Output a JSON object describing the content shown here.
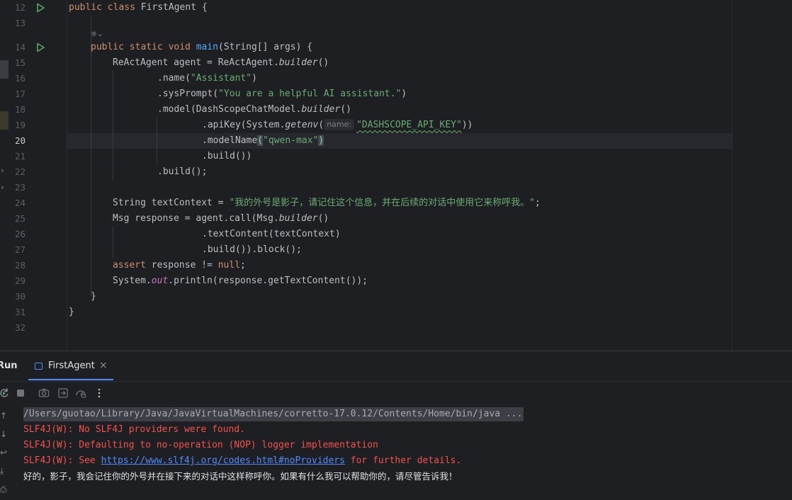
{
  "editor": {
    "line_numbers": [
      "12",
      "13",
      "14",
      "15",
      "16",
      "17",
      "18",
      "19",
      "20",
      "21",
      "22",
      "23",
      "24",
      "25",
      "26",
      "27",
      "28",
      "29",
      "30",
      "31",
      "32"
    ],
    "current_line": "20",
    "ai_hint": "⎈⌄",
    "hint_name": "name:"
  },
  "code": {
    "l12": {
      "kw1": "public class ",
      "name": "FirstAgent {"
    },
    "l14": {
      "kw": "public static void ",
      "fn": "main",
      "rest": "(String[] args) {"
    },
    "l15": {
      "a": "ReActAgent agent = ReActAgent.",
      "it": "builder",
      "b": "()"
    },
    "l16": {
      "a": ".name(",
      "s": "\"Assistant\"",
      "b": ")"
    },
    "l17": {
      "a": ".sysPrompt(",
      "s": "\"You are a helpful AI assistant.\"",
      "b": ")"
    },
    "l18": {
      "a": ".model(DashScopeChatModel.",
      "it": "builder",
      "b": "()"
    },
    "l19": {
      "a": ".apiKey(System.",
      "it": "getenv",
      "b": "(",
      "s": "\"DASHSCOPE_API_KEY\"",
      "c": "))"
    },
    "l20": {
      "a": ".modelName",
      "p1": "(",
      "s": "\"qwen-max\"",
      "p2": ")"
    },
    "l21": {
      "a": ".build())"
    },
    "l22": {
      "a": ".build();"
    },
    "l24": {
      "a": "String textContext = ",
      "s": "\"我的外号是影子，请记住这个信息，并在后续的对话中使用它来称呼我。\"",
      "b": ";"
    },
    "l25": {
      "a": "Msg response = agent.call(Msg.",
      "it": "builder",
      "b": "()"
    },
    "l26": {
      "a": ".textContent(textContext)"
    },
    "l27": {
      "a": ".build()).block();"
    },
    "l28": {
      "kw": "assert ",
      "a": "response != ",
      "kw2": "null",
      "b": ";"
    },
    "l29": {
      "a": "System.",
      "f": "out",
      "b": ".println(response.getTextContent());"
    },
    "l30": {
      "a": "}"
    },
    "l31": {
      "a": "}"
    }
  },
  "run_panel": {
    "title": "Run",
    "tab_label": "FirstAgent",
    "tab_close": "×",
    "toolbar_icons": [
      "rerun-icon",
      "stop-icon",
      "camera-icon",
      "restore-layout-icon",
      "profiler-icon",
      "more-icon"
    ],
    "console": {
      "cmd": "/Users/guotao/Library/Java/JavaVirtualMachines/corretto-17.0.12/Contents/Home/bin/java ...",
      "err1": "SLF4J(W): No SLF4J providers were found.",
      "err2": "SLF4J(W): Defaulting to no-operation (NOP) logger implementation",
      "err3_pre": "SLF4J(W): See ",
      "err3_link": "https://www.slf4j.org/codes.html#noProviders",
      "err3_post": " for further details.",
      "output": "好的，影子，我会记住你的外号并在接下来的对话中这样称呼你。如果有什么我可以帮助你的，请尽管告诉我！"
    }
  },
  "colors": {
    "keyword": "#cf8e6d",
    "string": "#6aab73",
    "function": "#56a8f5",
    "error": "#f0524f",
    "link": "#548af7",
    "run_green": "#59a869"
  }
}
